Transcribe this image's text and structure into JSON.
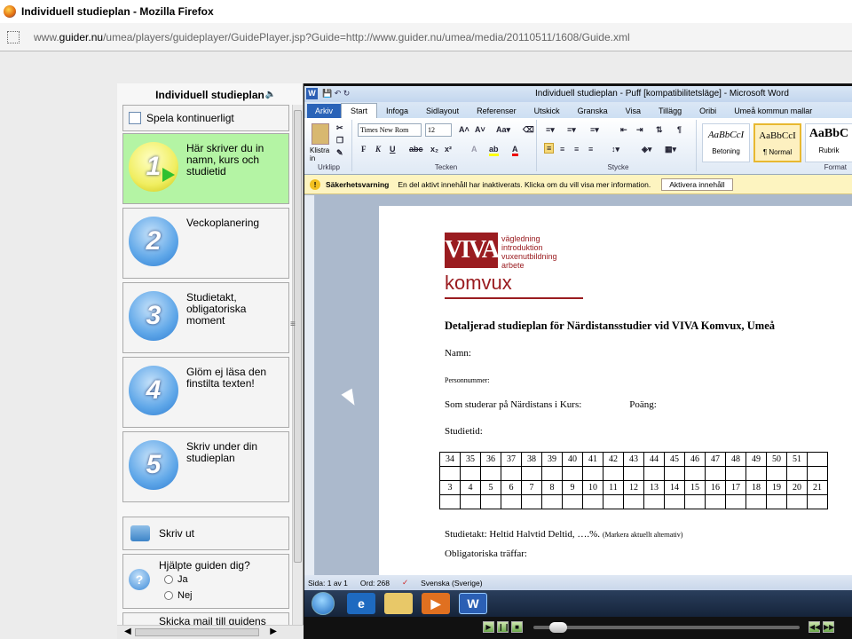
{
  "browser": {
    "title": "Individuell studieplan - Mozilla Firefox",
    "url_prefix": "www.",
    "url_domain": "guider.nu",
    "url_rest": "/umea/players/guideplayer/GuidePlayer.jsp?Guide=http://www.guider.nu/umea/media/20110511/1608/Guide.xml"
  },
  "guide": {
    "title": "Individuell studieplan",
    "continuous_label": "Spela kontinuerligt",
    "steps": [
      {
        "num": "1",
        "label": "Här skriver du in namn, kurs och studietid",
        "active": true
      },
      {
        "num": "2",
        "label": "Veckoplanering"
      },
      {
        "num": "3",
        "label": "Studietakt, obligatoriska moment"
      },
      {
        "num": "4",
        "label": "Glöm ej läsa den finstilta texten!"
      },
      {
        "num": "5",
        "label": "Skriv under din studieplan"
      }
    ],
    "print_label": "Skriv ut",
    "help_question": "Hjälpte guiden dig?",
    "help_yes": "Ja",
    "help_no": "Nej",
    "mail_label": "Skicka mail till guidens"
  },
  "word": {
    "title": "Individuell studieplan - Puff [kompatibilitetsläge] - Microsoft Word",
    "tabs": [
      "Arkiv",
      "Start",
      "Infoga",
      "Sidlayout",
      "Referenser",
      "Utskick",
      "Granska",
      "Visa",
      "Tillägg",
      "Oribi",
      "Umeå kommun mallar"
    ],
    "font_name": "Times New Rom",
    "font_size": "12",
    "group_clipboard": "Urklipp",
    "group_font": "Tecken",
    "group_paragraph": "Stycke",
    "group_styles": "Format",
    "paste_label": "Klistra in",
    "styles": [
      {
        "preview": "AaBbCcI",
        "name": "Betoning"
      },
      {
        "preview": "AaBbCcI",
        "name": "¶ Normal"
      },
      {
        "preview": "AaBbC",
        "name": "Rubrik"
      }
    ],
    "security": {
      "title": "Säkerhetsvarning",
      "message": "En del aktivt innehåll har inaktiverats. Klicka om du vill visa mer information.",
      "button": "Aktivera innehåll"
    },
    "status": {
      "page": "Sida: 1 av 1",
      "words": "Ord: 268",
      "language": "Svenska (Sverige)"
    }
  },
  "document": {
    "logo_letters": "VIVA",
    "logo_tags": [
      "vägledning",
      "introduktion",
      "vuxenutbildning",
      "arbete"
    ],
    "logo_name": "komvux",
    "heading": "Detaljerad studieplan för Närdistansstudier vid VIVA Komvux, Umeå",
    "name_label": "Namn:",
    "personnummer_label": "Personnummer:",
    "course_label": "Som studerar på Närdistans i Kurs:",
    "points_label": "Poäng:",
    "studietid_label": "Studietid:",
    "weeks_row1": [
      "34",
      "35",
      "36",
      "37",
      "38",
      "39",
      "40",
      "41",
      "42",
      "43",
      "44",
      "45",
      "46",
      "47",
      "48",
      "49",
      "50",
      "51",
      ""
    ],
    "weeks_row2": [
      "3",
      "4",
      "5",
      "6",
      "7",
      "8",
      "9",
      "10",
      "11",
      "12",
      "13",
      "14",
      "15",
      "16",
      "17",
      "18",
      "19",
      "20",
      "21"
    ],
    "studietakt": "Studietakt: Heltid     Halvtid        Deltid, ….%.",
    "studietakt_note": "(Markera aktuellt alternativ)",
    "obligatoriska": "Obligatoriska träffar:"
  },
  "colors": {
    "active_step": "#b4f4a4",
    "brand_red": "#9a1c20"
  }
}
